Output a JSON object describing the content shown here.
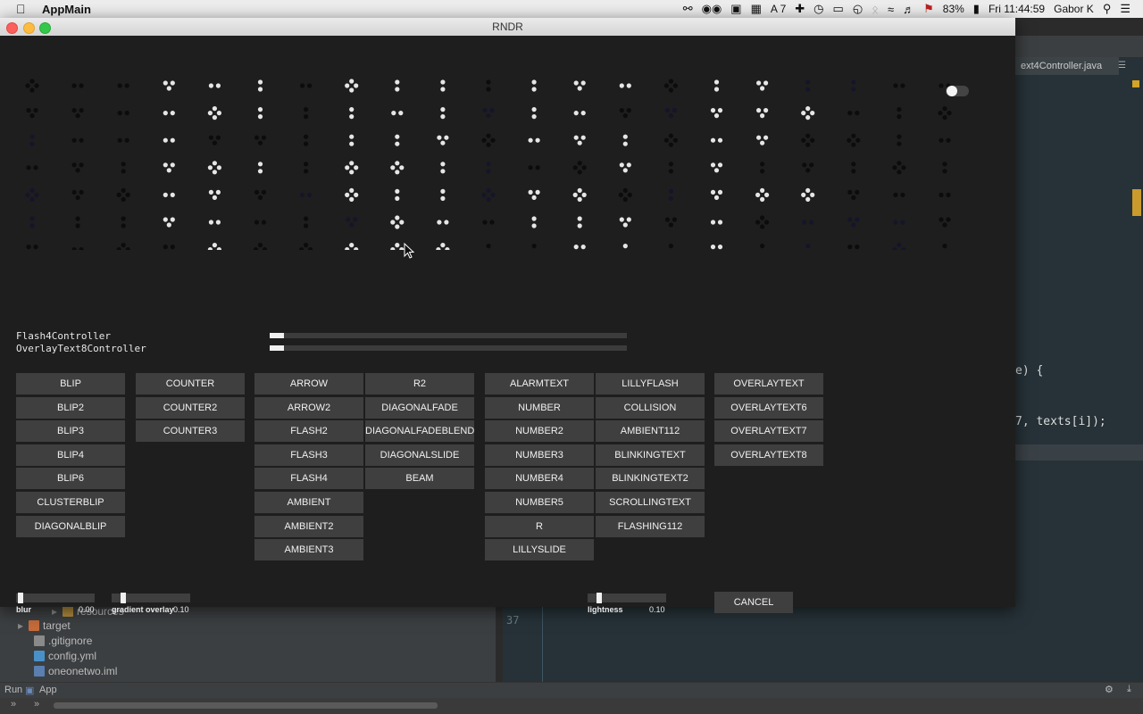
{
  "menubar": {
    "app_name": "AppMain",
    "battery": "83%",
    "input_badge": "7",
    "datetime": "Fri 11:44:59",
    "user": "Gabor K"
  },
  "window": {
    "title": "RNDR"
  },
  "controllers": [
    {
      "label": "Flash4Controller",
      "progress": 0.04
    },
    {
      "label": "OverlayText8Controller",
      "progress": 0.04
    }
  ],
  "button_columns": [
    [
      "BLIP",
      "BLIP2",
      "BLIP3",
      "BLIP4",
      "BLIP6",
      "CLUSTERBLIP",
      "DIAGONALBLIP"
    ],
    [
      "COUNTER",
      "COUNTER2",
      "COUNTER3"
    ],
    [
      "ARROW",
      "ARROW2",
      "FLASH2",
      "FLASH3",
      "FLASH4",
      "AMBIENT",
      "AMBIENT2",
      "AMBIENT3"
    ],
    [
      "R2",
      "DIAGONALFADE",
      "DIAGONALFADEBLEND",
      "DIAGONALSLIDE",
      "BEAM"
    ],
    [
      "ALARMTEXT",
      "NUMBER",
      "NUMBER2",
      "NUMBER3",
      "NUMBER4",
      "NUMBER5",
      "R",
      "LILLYSLIDE"
    ],
    [
      "LILLYFLASH",
      "COLLISION",
      "AMBIENT112",
      "BLINKINGTEXT",
      "BLINKINGTEXT2",
      "SCROLLINGTEXT",
      "FLASHING112"
    ],
    [
      "OVERLAYTEXT",
      "OVERLAYTEXT6",
      "OVERLAYTEXT7",
      "OVERLAYTEXT8"
    ]
  ],
  "sliders": {
    "blur": {
      "label": "blur",
      "value": "0.00"
    },
    "gradient": {
      "label": "gradient overlay",
      "value": "0.10"
    },
    "lightness": {
      "label": "lightness",
      "value": "0.10"
    }
  },
  "cancel_label": "CANCEL",
  "ide": {
    "tab": "ext4Controller.java",
    "code_line1": "e) {",
    "code_line2": "7, texts[i]);",
    "gutter_num": "37",
    "tree": {
      "resources": "resources",
      "target": "target",
      "gitignore": ".gitignore",
      "config": "config.yml",
      "iml": "oneonetwo.iml"
    },
    "run_label": "Run",
    "app_label": "App"
  },
  "colors": {
    "button_bg": "#3f3f3f",
    "window_bg": "#1e1e1e",
    "dot_bright": "#e6e6e6",
    "dot_dim": "#0c0c0c",
    "dot_blue": "#15152a"
  }
}
